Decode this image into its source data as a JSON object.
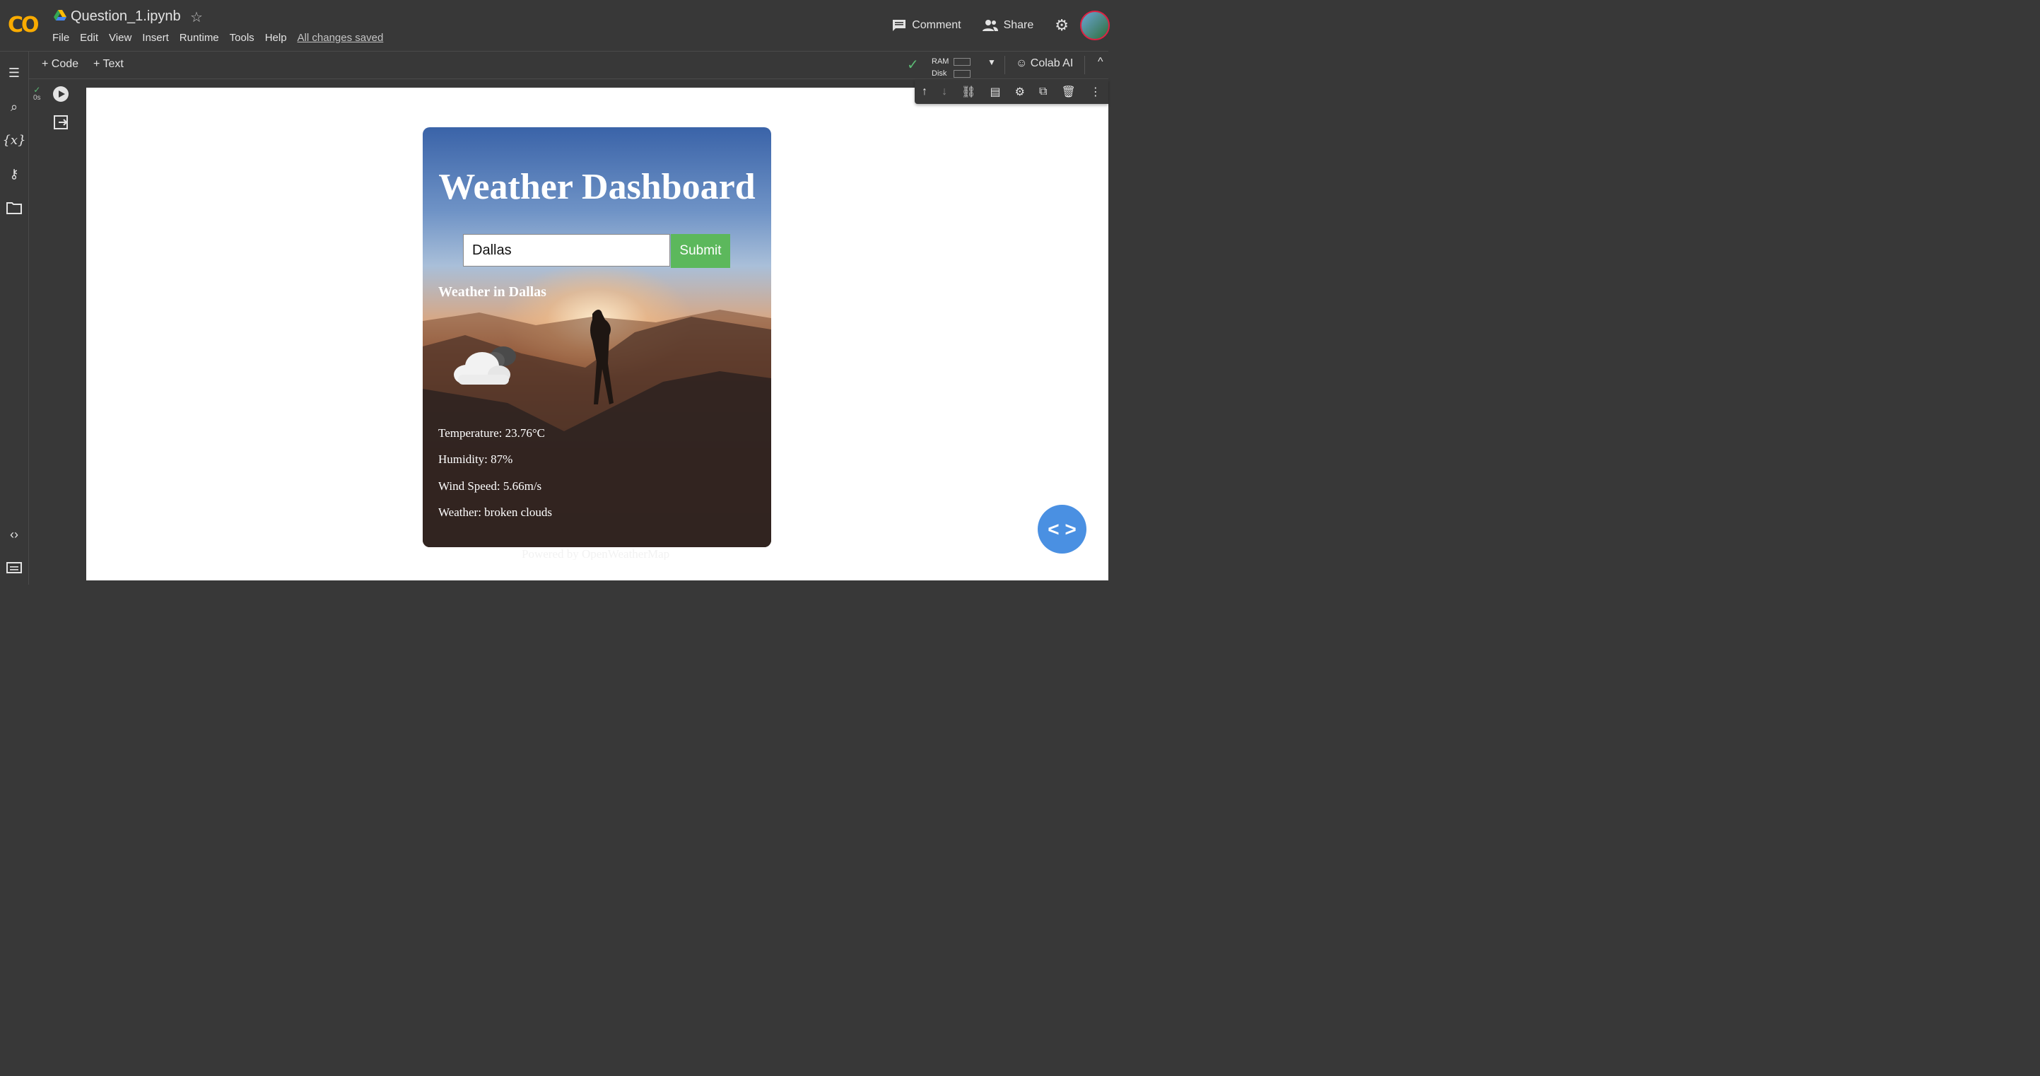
{
  "app": {
    "logo": "CO",
    "notebook_title": "Question_1.ipynb"
  },
  "menu": [
    "File",
    "Edit",
    "View",
    "Insert",
    "Runtime",
    "Tools",
    "Help"
  ],
  "save_status": "All changes saved",
  "header_actions": {
    "comment": "Comment",
    "share": "Share"
  },
  "toolbar": {
    "add_code": "+ Code",
    "add_text": "+ Text",
    "ram_label": "RAM",
    "disk_label": "Disk",
    "colab_ai": "Colab AI"
  },
  "cell": {
    "exec_time": "0s"
  },
  "dashboard": {
    "title": "Weather Dashboard",
    "city_value": "Dallas",
    "submit_label": "Submit",
    "heading": "Weather in Dallas",
    "temperature": "Temperature: 23.76°C",
    "humidity": "Humidity: 87%",
    "wind": "Wind Speed: 5.66m/s",
    "condition": "Weather: broken clouds",
    "footer": "Powered by OpenWeatherMap"
  },
  "colors": {
    "accent_green": "#5cb85c",
    "fab_blue": "#4a90e2",
    "status_green": "#5bb974"
  }
}
